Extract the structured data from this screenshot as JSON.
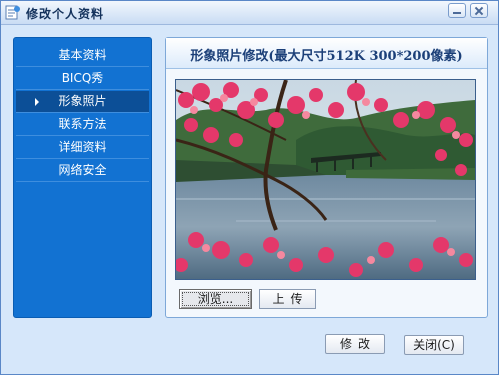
{
  "window": {
    "title": "修改个人资料",
    "icon": "user-profile-icon",
    "controls": [
      "minimize-icon",
      "close-icon"
    ]
  },
  "sidebar": {
    "items": [
      {
        "label": "基本资料",
        "active": false
      },
      {
        "label": "BICQ秀",
        "active": false
      },
      {
        "label": "形象照片",
        "active": true
      },
      {
        "label": "联系方法",
        "active": false
      },
      {
        "label": "详细资料",
        "active": false
      },
      {
        "label": "网络安全",
        "active": false
      }
    ]
  },
  "content": {
    "title": "形象照片修改(最大尺寸512K 300*200像素)",
    "photo": "pink blossom branches over a pond with a bridge and trees",
    "browse_label": "浏览...",
    "upload_label": "上传"
  },
  "footer": {
    "modify_label": "修改",
    "close_label": "关闭(C)"
  },
  "colors": {
    "sidebar_bg": "#1272d2",
    "sidebar_active": "#0c4f97",
    "window_bg": "#d6e7fa",
    "title_text": "#1b3f78"
  }
}
